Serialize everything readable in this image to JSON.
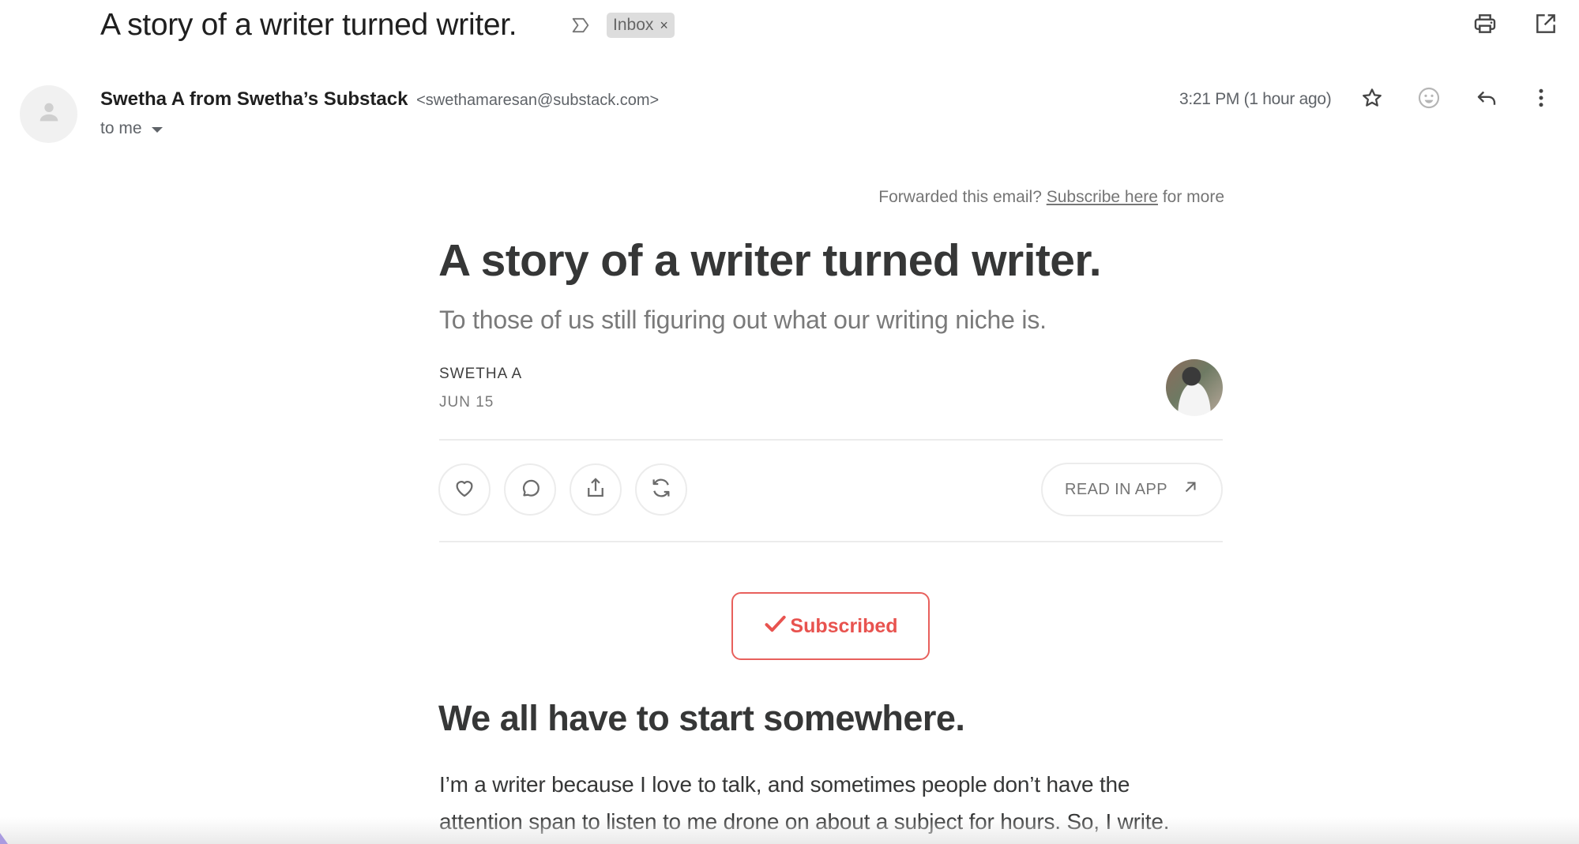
{
  "header": {
    "subject": "A story of a writer turned writer.",
    "label_chip": "Inbox",
    "label_chip_remove": "×",
    "icons": {
      "importance": "label-importance-icon",
      "print": "print-icon",
      "open_new_window": "open-in-new-icon"
    }
  },
  "message": {
    "sender_name": "Swetha A from Swetha’s Substack",
    "sender_email": "<swethamaresan@substack.com>",
    "recipient": "to me",
    "timestamp": "3:21 PM (1 hour ago)",
    "actions": [
      "star-icon",
      "emoji-reaction-icon",
      "reply-icon",
      "more-vert-icon"
    ]
  },
  "newsletter": {
    "forwarded_prefix": "Forwarded this email?",
    "subscribe_link": "Subscribe here",
    "forwarded_suffix": "for more",
    "title": "A story of a writer turned writer.",
    "subtitle": "To those of us still figuring out what our writing niche is.",
    "author": "SWETHA A",
    "date": "JUN 15",
    "engagement_buttons": [
      "like",
      "comment",
      "share",
      "restack"
    ],
    "read_in_app": "READ IN APP",
    "subscribed_label": "Subscribed",
    "section_heading": "We all have to start somewhere.",
    "body_lines": [
      "I’m a writer because I love to talk, and sometimes people don’t have the",
      "attention span to listen to me drone on about a subject for hours. So, I write."
    ]
  },
  "colors": {
    "subscribed_red": "#e8534f",
    "text_dark": "#363737",
    "text_muted": "#757575",
    "chip_bg": "#dddddd"
  }
}
